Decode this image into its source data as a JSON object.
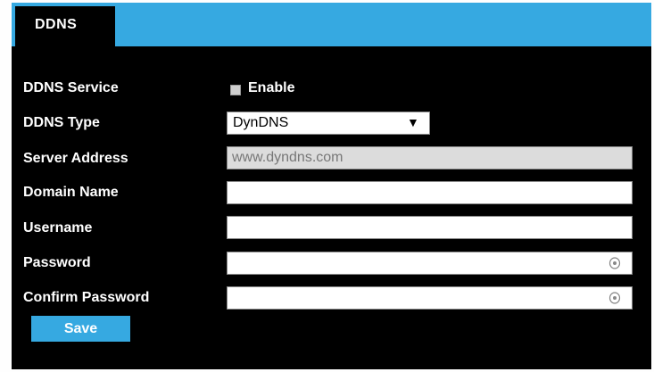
{
  "tab": {
    "label": "DDNS"
  },
  "form": {
    "ddns_service": {
      "label": "DDNS Service",
      "checkbox_label": "Enable",
      "checked": false
    },
    "ddns_type": {
      "label": "DDNS Type",
      "value": "DynDNS"
    },
    "server_address": {
      "label": "Server Address",
      "value": "www.dyndns.com"
    },
    "domain_name": {
      "label": "Domain Name",
      "value": ""
    },
    "username": {
      "label": "Username",
      "value": ""
    },
    "password": {
      "label": "Password",
      "value": ""
    },
    "confirm_password": {
      "label": "Confirm Password",
      "value": ""
    }
  },
  "actions": {
    "save_label": "Save"
  },
  "icons": {
    "select_arrow": "▼",
    "password_reveal": "eye-icon"
  },
  "colors": {
    "accent": "#36a9e1",
    "background": "#000000"
  }
}
